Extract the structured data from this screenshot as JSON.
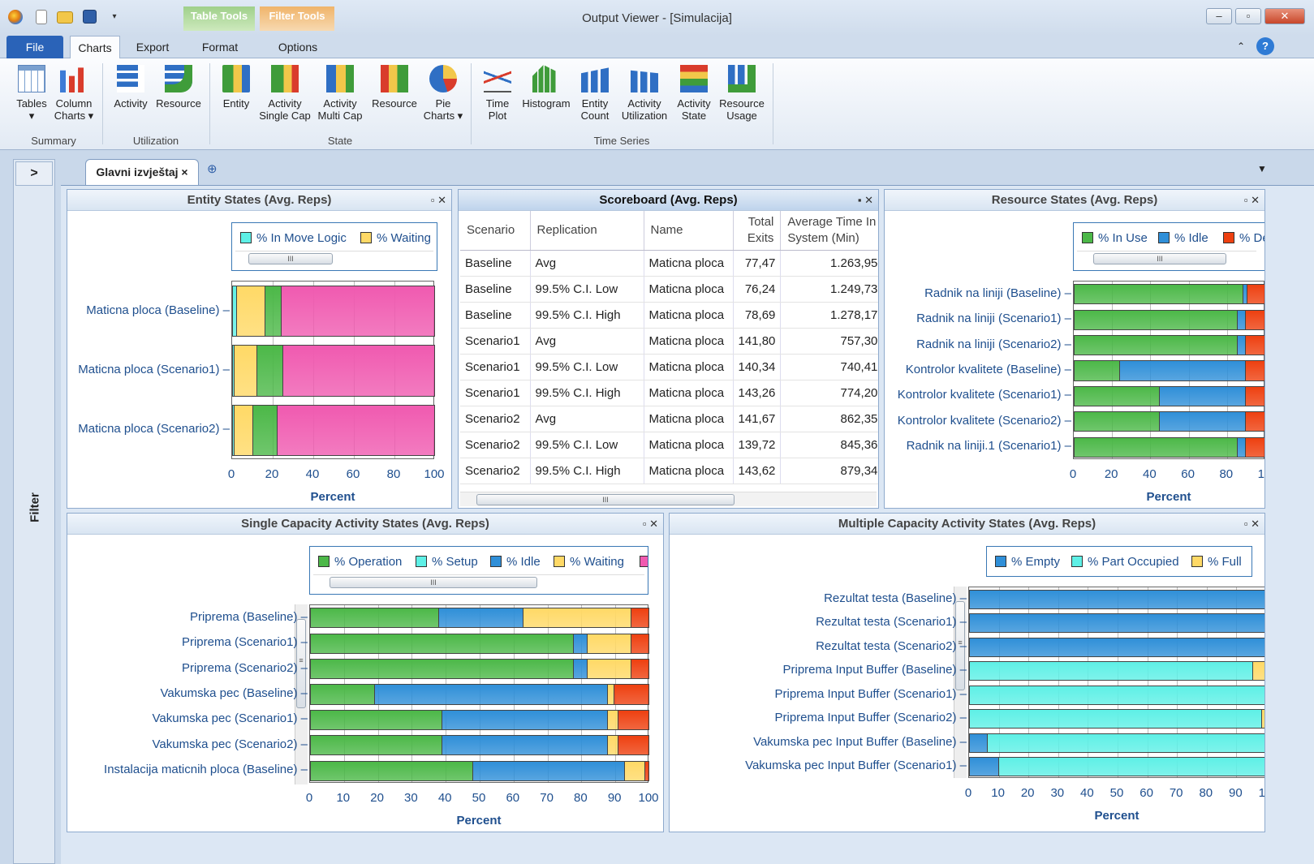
{
  "window": {
    "title": "Output Viewer - [Simulacija]",
    "minimize": "–",
    "restore": "▫",
    "close": "✕"
  },
  "context_tabs": {
    "table_tools": "Table Tools",
    "filter_tools": "Filter Tools"
  },
  "ribbon_tabs": [
    "File",
    "Charts",
    "Export",
    "Format",
    "Options"
  ],
  "ribbon": {
    "buttons": [
      {
        "label": "Tables",
        "sub": "▾"
      },
      {
        "label": "Column",
        "sub": "Charts ▾"
      },
      {
        "label": "Activity",
        "sub": ""
      },
      {
        "label": "Resource",
        "sub": ""
      },
      {
        "label": "Entity",
        "sub": ""
      },
      {
        "label": "Activity",
        "sub": "Single Cap"
      },
      {
        "label": "Activity",
        "sub": "Multi Cap"
      },
      {
        "label": "Resource",
        "sub": ""
      },
      {
        "label": "Pie",
        "sub": "Charts ▾"
      },
      {
        "label": "Time",
        "sub": "Plot"
      },
      {
        "label": "Histogram",
        "sub": ""
      },
      {
        "label": "Entity",
        "sub": "Count"
      },
      {
        "label": "Activity",
        "sub": "Utilization"
      },
      {
        "label": "Activity",
        "sub": "State"
      },
      {
        "label": "Resource",
        "sub": "Usage"
      }
    ],
    "groups": [
      "Summary",
      "Utilization",
      "State",
      "Time Series"
    ]
  },
  "filter_label": "Filter",
  "filter_toggle": ">",
  "doc_tab": {
    "label": "Glavni izvještaj ×",
    "add": "⊕"
  },
  "colors": {
    "green": "#4cb848",
    "cyan": "#5ef0e6",
    "yellow": "#ffd966",
    "pink": "#f05ab0",
    "blue": "#2f8fd8",
    "red": "#ee4010"
  },
  "entity_states": {
    "title": "Entity States (Avg. Reps)",
    "legend": [
      "% In Move Logic",
      "% Waiting"
    ],
    "xlabel": "Percent",
    "ticks": [
      "0",
      "20",
      "40",
      "60",
      "80",
      "100"
    ],
    "rows": [
      {
        "label": "Maticna ploca (Baseline)",
        "values": [
          2,
          14,
          8,
          76
        ]
      },
      {
        "label": "Maticna ploca (Scenario1)",
        "values": [
          1,
          11,
          13,
          75
        ]
      },
      {
        "label": "Maticna ploca (Scenario2)",
        "values": [
          1,
          9,
          12,
          78
        ]
      }
    ]
  },
  "scoreboard": {
    "title": "Scoreboard (Avg. Reps)",
    "columns": [
      "Scenario",
      "Replication",
      "Name",
      "Total Exits",
      "Average Time In System (Min)"
    ],
    "rows": [
      [
        "Baseline",
        "Avg",
        "Maticna ploca",
        "77,47",
        "1.263,95"
      ],
      [
        "Baseline",
        "99.5% C.I. Low",
        "Maticna ploca",
        "76,24",
        "1.249,73"
      ],
      [
        "Baseline",
        "99.5% C.I. High",
        "Maticna ploca",
        "78,69",
        "1.278,17"
      ],
      [
        "Scenario1",
        "Avg",
        "Maticna ploca",
        "141,80",
        "757,30"
      ],
      [
        "Scenario1",
        "99.5% C.I. Low",
        "Maticna ploca",
        "140,34",
        "740,41"
      ],
      [
        "Scenario1",
        "99.5% C.I. High",
        "Maticna ploca",
        "143,26",
        "774,20"
      ],
      [
        "Scenario2",
        "Avg",
        "Maticna ploca",
        "141,67",
        "862,35"
      ],
      [
        "Scenario2",
        "99.5% C.I. Low",
        "Maticna ploca",
        "139,72",
        "845,36"
      ],
      [
        "Scenario2",
        "99.5% C.I. High",
        "Maticna ploca",
        "143,62",
        "879,34"
      ]
    ]
  },
  "resource_states": {
    "title": "Resource States (Avg. Reps)",
    "legend": [
      "% In Use",
      "% Idle",
      "% De"
    ],
    "xlabel": "Percent",
    "ticks": [
      "0",
      "20",
      "40",
      "60",
      "80",
      "10"
    ],
    "rows": [
      {
        "label": "Radnik na liniji (Baseline)",
        "values": [
          89,
          2,
          9
        ]
      },
      {
        "label": "Radnik na liniji (Scenario1)",
        "values": [
          86,
          4,
          10
        ]
      },
      {
        "label": "Radnik na liniji (Scenario2)",
        "values": [
          86,
          4,
          10
        ]
      },
      {
        "label": "Kontrolor kvalitete (Baseline)",
        "values": [
          24,
          66,
          10
        ]
      },
      {
        "label": "Kontrolor kvalitete (Scenario1)",
        "values": [
          45,
          45,
          10
        ]
      },
      {
        "label": "Kontrolor kvalitete (Scenario2)",
        "values": [
          45,
          45,
          10
        ]
      },
      {
        "label": "Radnik na liniji.1 (Scenario1)",
        "values": [
          86,
          4,
          10
        ]
      }
    ]
  },
  "single_cap": {
    "title": "Single Capacity Activity States (Avg. Reps)",
    "legend": [
      "% Operation",
      "% Setup",
      "% Idle",
      "% Waiting"
    ],
    "xlabel": "Percent",
    "ticks": [
      "0",
      "10",
      "20",
      "30",
      "40",
      "50",
      "60",
      "70",
      "80",
      "90",
      "100"
    ],
    "rows": [
      {
        "label": "Priprema (Baseline)",
        "values": [
          38,
          25,
          32,
          5
        ]
      },
      {
        "label": "Priprema (Scenario1)",
        "values": [
          78,
          4,
          13,
          5
        ]
      },
      {
        "label": "Priprema (Scenario2)",
        "values": [
          78,
          4,
          13,
          5
        ]
      },
      {
        "label": "Vakumska pec (Baseline)",
        "values": [
          19,
          69,
          2,
          10
        ]
      },
      {
        "label": "Vakumska pec (Scenario1)",
        "values": [
          39,
          49,
          3,
          9
        ]
      },
      {
        "label": "Vakumska pec (Scenario2)",
        "values": [
          39,
          49,
          3,
          9
        ]
      },
      {
        "label": "Instalacija maticnih ploca (Baseline)",
        "values": [
          48,
          45,
          6,
          1
        ]
      }
    ]
  },
  "multi_cap": {
    "title": "Multiple Capacity Activity States (Avg. Reps)",
    "legend": [
      "% Empty",
      "% Part Occupied",
      "% Full"
    ],
    "xlabel": "Percent",
    "ticks": [
      "0",
      "10",
      "20",
      "30",
      "40",
      "50",
      "60",
      "70",
      "80",
      "90",
      "10"
    ],
    "rows": [
      {
        "label": "Rezultat testa  (Baseline)",
        "values": [
          100,
          0,
          0
        ]
      },
      {
        "label": "Rezultat testa  (Scenario1)",
        "values": [
          100,
          0,
          0
        ]
      },
      {
        "label": "Rezultat testa  (Scenario2)",
        "values": [
          100,
          0,
          0
        ]
      },
      {
        "label": "Priprema Input Buffer (Baseline)",
        "values": [
          0,
          96,
          4
        ]
      },
      {
        "label": "Priprema Input Buffer (Scenario1)",
        "values": [
          0,
          100,
          0
        ]
      },
      {
        "label": "Priprema Input Buffer (Scenario2)",
        "values": [
          0,
          99,
          1
        ]
      },
      {
        "label": "Vakumska pec Input Buffer (Baseline)",
        "values": [
          6,
          94,
          0
        ]
      },
      {
        "label": "Vakumska pec Input Buffer (Scenario1)",
        "values": [
          10,
          90,
          0
        ]
      }
    ]
  }
}
